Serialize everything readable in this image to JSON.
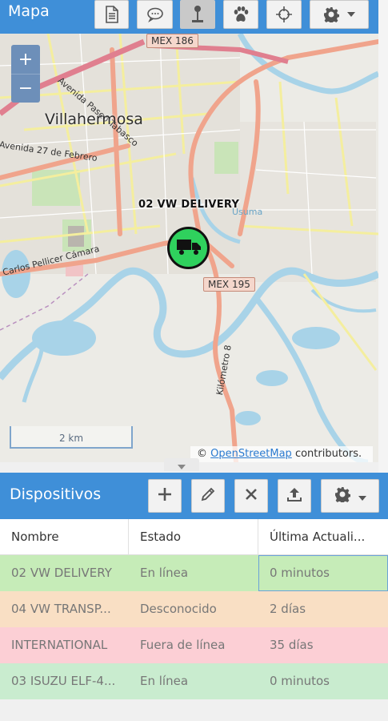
{
  "map_panel": {
    "title": "Mapa",
    "toolbar": [
      {
        "name": "report-icon",
        "active": false
      },
      {
        "name": "chat-icon",
        "active": false
      },
      {
        "name": "geofence-icon",
        "active": true
      },
      {
        "name": "paw-icon",
        "active": false
      },
      {
        "name": "crosshair-icon",
        "active": false
      },
      {
        "name": "gear-icon",
        "active": false
      }
    ],
    "zoom_in": "+",
    "zoom_out": "−",
    "city_label": "Villahermosa",
    "vehicle_label": "02 VW DELIVERY",
    "shields": {
      "top": "MEX 186",
      "mid": "MEX 195"
    },
    "roads": {
      "paseo": "Avenida Paseo Tabasco",
      "febrero": "Avenida 27 de Febrero",
      "pellicer": "Carlos Pellicer Cámara",
      "kilometro": "Kilómetro 8",
      "usuma": "Usuma"
    },
    "scale": "2 km",
    "attribution": {
      "prefix": "© ",
      "link": "OpenStreetMap",
      "suffix": " contributors."
    }
  },
  "devices_panel": {
    "title": "Dispositivos",
    "buttons": [
      "add-icon",
      "edit-icon",
      "remove-icon",
      "upload-icon",
      "gear-icon"
    ],
    "columns": [
      "Nombre",
      "Estado",
      "Última Actuali..."
    ],
    "rows": [
      {
        "name": "02 VW DELIVERY",
        "status": "En línea",
        "updated": "0 minutos",
        "color": "#c6ecb8"
      },
      {
        "name": "04 VW TRANSP...",
        "status": "Desconocido",
        "updated": "2 días",
        "color": "#f9dfc4"
      },
      {
        "name": "INTERNATIONAL",
        "status": "Fuera de línea",
        "updated": "35 días",
        "color": "#fccfd5"
      },
      {
        "name": "03 ISUZU ELF-4...",
        "status": "En línea",
        "updated": "0 minutos",
        "color": "#c9eccf"
      }
    ]
  },
  "colors": {
    "accent": "#3f8fd8",
    "marker": "#2fd15d"
  }
}
